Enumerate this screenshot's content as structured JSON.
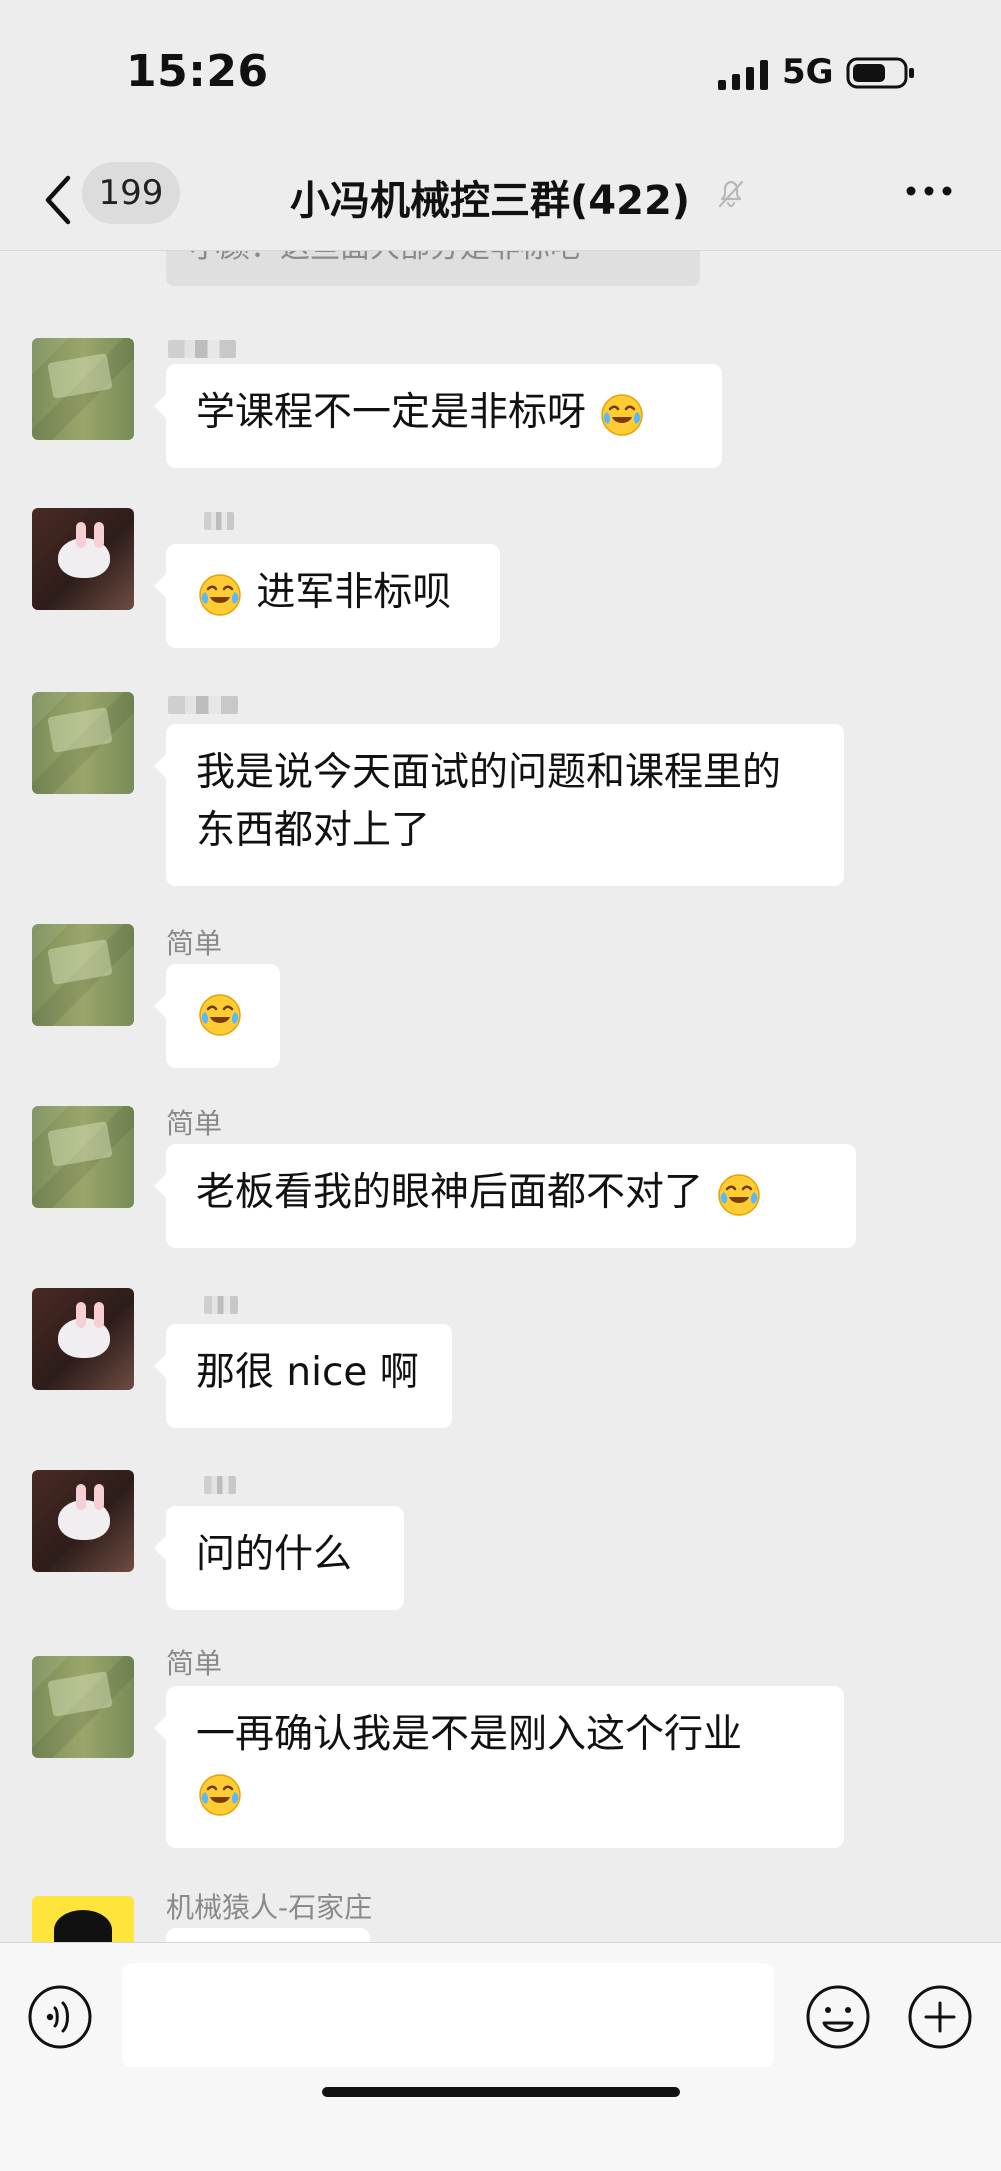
{
  "status_bar": {
    "time": "15:26",
    "network": "5G"
  },
  "nav": {
    "unread_count": "199",
    "title": "小冯机械控三群(422)"
  },
  "quoted_preview": "小颜：这些面大部分是非标吧",
  "messages": [
    {
      "sender": "",
      "avatar": "green-grass",
      "text": "学课程不一定是非标呀",
      "emoji": "face-with-tears-of-joy"
    },
    {
      "sender": "",
      "avatar": "white-rabbit",
      "text": "进军非标呗",
      "emoji": "face-with-tears-of-joy"
    },
    {
      "sender": "",
      "avatar": "green-grass",
      "text": "我是说今天面试的问题和课程里的东西都对上了"
    },
    {
      "sender": "简单",
      "avatar": "green-grass",
      "emoji": "face-with-tears-of-joy"
    },
    {
      "sender": "简单",
      "avatar": "green-grass",
      "text": "老板看我的眼神后面都不对了",
      "emoji": "face-with-tears-of-joy"
    },
    {
      "sender": "",
      "avatar": "white-rabbit",
      "text": "那很 nice 啊"
    },
    {
      "sender": "",
      "avatar": "white-rabbit",
      "text": "问的什么"
    },
    {
      "sender": "简单",
      "avatar": "green-grass",
      "text": "一再确认我是不是刚入这个行业",
      "emoji": "face-with-tears-of-joy"
    },
    {
      "sender": "机械猿人-石家庄",
      "avatar": "yellow-cartoon"
    }
  ],
  "composer": {
    "value": ""
  }
}
